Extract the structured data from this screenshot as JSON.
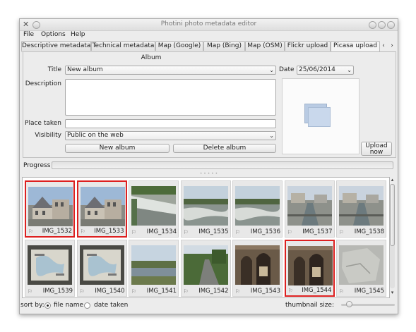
{
  "window": {
    "title": "Photini photo metadata editor"
  },
  "menu": [
    "File",
    "Options",
    "Help"
  ],
  "tabs": [
    {
      "label": "Descriptive metadata",
      "active": false
    },
    {
      "label": "Technical metadata",
      "active": false
    },
    {
      "label": "Map (Google)",
      "active": false
    },
    {
      "label": "Map (Bing)",
      "active": false
    },
    {
      "label": "Map (OSM)",
      "active": false
    },
    {
      "label": "Flickr upload",
      "active": false
    },
    {
      "label": "Picasa upload",
      "active": true
    }
  ],
  "tab_scroll": {
    "left": "‹",
    "right": "›"
  },
  "album": {
    "heading": "Album",
    "title_label": "Title",
    "title_value": "New album",
    "date_label": "Date",
    "date_value": "25/06/2014",
    "description_label": "Description",
    "description_value": "",
    "place_label": "Place taken",
    "place_value": "",
    "visibility_label": "Visibility",
    "visibility_value": "Public on the web",
    "new_album_button": "New album",
    "delete_album_button": "Delete album"
  },
  "upload_button": "Upload now",
  "progress": {
    "label": "Progress",
    "value": 0
  },
  "thumbnails": [
    {
      "name": "IMG_1532",
      "selected": true,
      "kind": "building"
    },
    {
      "name": "IMG_1533",
      "selected": true,
      "kind": "building"
    },
    {
      "name": "IMG_1534",
      "selected": false,
      "kind": "weir"
    },
    {
      "name": "IMG_1535",
      "selected": false,
      "kind": "river"
    },
    {
      "name": "IMG_1536",
      "selected": false,
      "kind": "river"
    },
    {
      "name": "IMG_1537",
      "selected": false,
      "kind": "lock"
    },
    {
      "name": "IMG_1538",
      "selected": false,
      "kind": "lock"
    },
    {
      "name": "IMG_1539",
      "selected": false,
      "kind": "map"
    },
    {
      "name": "IMG_1540",
      "selected": false,
      "kind": "map"
    },
    {
      "name": "IMG_1541",
      "selected": false,
      "kind": "landscape"
    },
    {
      "name": "IMG_1542",
      "selected": false,
      "kind": "road"
    },
    {
      "name": "IMG_1543",
      "selected": false,
      "kind": "ruin"
    },
    {
      "name": "IMG_1544",
      "selected": true,
      "kind": "ruin"
    },
    {
      "name": "IMG_1545",
      "selected": false,
      "kind": "stone"
    }
  ],
  "sort": {
    "label": "sort by:",
    "option_file": "file name",
    "option_date": "date taken",
    "selected": "file name"
  },
  "thumbnail_size": {
    "label": "thumbnail size:",
    "level": 0.15
  },
  "colors": {
    "selection": "#dd2020",
    "window_bg": "#ececec"
  }
}
